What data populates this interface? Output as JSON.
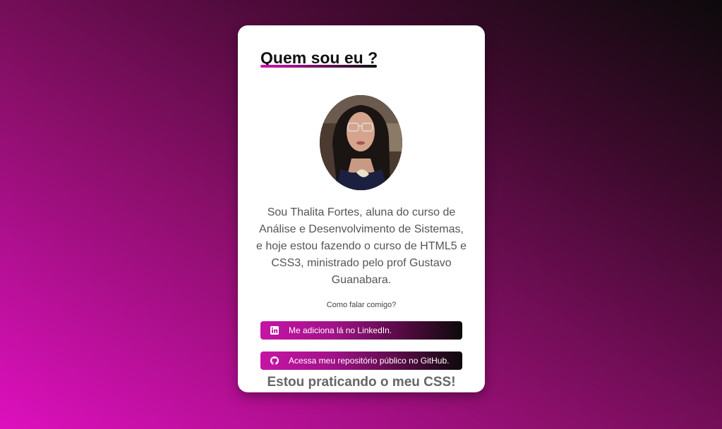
{
  "page": {
    "background_colors": [
      "#de10be",
      "#8a0f6a",
      "#0c0a0b"
    ]
  },
  "card": {
    "title": "Quem sou eu ?",
    "avatar_icon": "profile-photo",
    "bio": "Sou Thalita Fortes, aluna do curso de Análise e Desenvolvimento de Sistemas, e hoje estou fazendo o curso de HTML5 e CSS3, ministrado pelo prof Gustavo Guanabara.",
    "contact_label": "Como falar comigo?",
    "links": [
      {
        "icon": "linkedin-icon",
        "label": "Me adiciona lá no LinkedIn."
      },
      {
        "icon": "github-icon",
        "label": "Acessa meu repositório público no GitHub."
      }
    ],
    "footer": "Estou praticando o meu CSS!"
  }
}
